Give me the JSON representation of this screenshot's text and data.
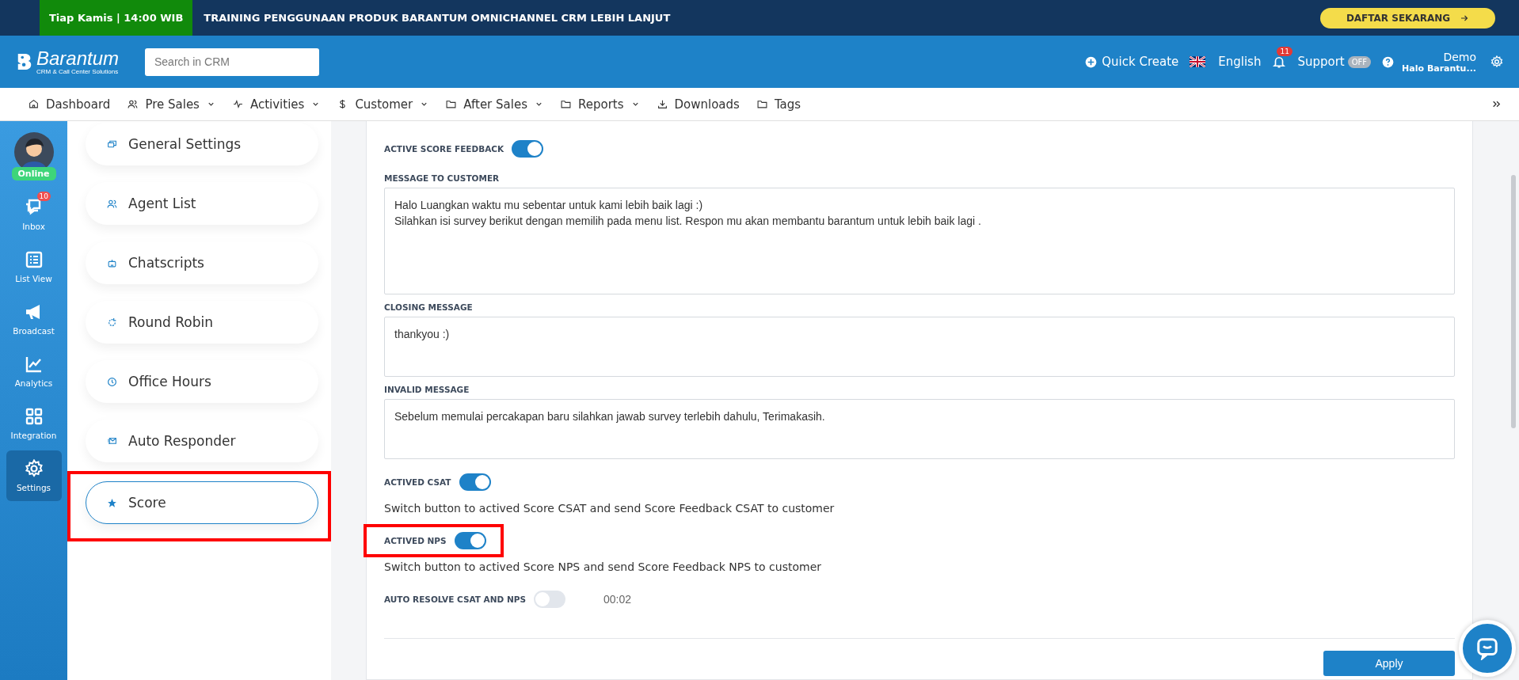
{
  "banner": {
    "tag": "Tiap Kamis | 14:00 WIB",
    "title": "TRAINING PENGGUNAAN PRODUK BARANTUM OMNICHANNEL CRM LEBIH LANJUT",
    "button": "DAFTAR SEKARANG"
  },
  "header": {
    "logo": {
      "name": "Barantum",
      "tagline": "CRM & Call Center Solutions"
    },
    "search": {
      "placeholder": "Search in CRM"
    },
    "quick_create": "Quick Create",
    "language": "English",
    "notifications": "11",
    "support": {
      "label": "Support",
      "badge": "OFF"
    },
    "user": {
      "name": "Demo",
      "company": "Halo Barantu..."
    }
  },
  "nav": [
    {
      "label": "Dashboard",
      "dropdown": false
    },
    {
      "label": "Pre Sales",
      "dropdown": true
    },
    {
      "label": "Activities",
      "dropdown": true
    },
    {
      "label": "Customer",
      "dropdown": true
    },
    {
      "label": "After Sales",
      "dropdown": true
    },
    {
      "label": "Reports",
      "dropdown": true
    },
    {
      "label": "Downloads",
      "dropdown": false
    },
    {
      "label": "Tags",
      "dropdown": false
    }
  ],
  "rail": {
    "status": "Online",
    "items": [
      {
        "label": "Inbox",
        "badge": "10",
        "selected": false
      },
      {
        "label": "List View",
        "selected": false
      },
      {
        "label": "Broadcast",
        "selected": false
      },
      {
        "label": "Analytics",
        "selected": false
      },
      {
        "label": "Integration",
        "selected": false
      },
      {
        "label": "Settings",
        "selected": true
      }
    ]
  },
  "settings_menu": [
    {
      "label": "General Settings",
      "selected": false,
      "highlighted": false
    },
    {
      "label": "Agent List",
      "selected": false,
      "highlighted": false
    },
    {
      "label": "Chatscripts",
      "selected": false,
      "highlighted": false
    },
    {
      "label": "Round Robin",
      "selected": false,
      "highlighted": false
    },
    {
      "label": "Office Hours",
      "selected": false,
      "highlighted": false
    },
    {
      "label": "Auto Responder",
      "selected": false,
      "highlighted": false
    },
    {
      "label": "Score",
      "selected": true,
      "highlighted": true
    }
  ],
  "form": {
    "fields": [
      {
        "kind": "toggle",
        "label": "ACTIVE SCORE FEEDBACK",
        "on": true,
        "highlighted": false
      },
      {
        "kind": "textarea",
        "label": "MESSAGE TO CUSTOMER",
        "value": "Halo Luangkan waktu mu sebentar untuk kami lebih baik lagi :)\nSilahkan isi survey berikut dengan memilih pada menu list. Respon mu akan membantu barantum untuk lebih baik lagi ."
      },
      {
        "kind": "textarea",
        "label": "CLOSING MESSAGE",
        "value": "thankyou :)"
      },
      {
        "kind": "textarea",
        "label": "INVALID MESSAGE",
        "value": "Sebelum memulai percakapan baru silahkan jawab survey terlebih dahulu, Terimakasih."
      },
      {
        "kind": "toggle",
        "label": "ACTIVED CSAT",
        "on": true,
        "highlighted": false,
        "help": "Switch button to actived Score CSAT and send Score Feedback CSAT to customer"
      },
      {
        "kind": "toggle",
        "label": "ACTIVED NPS",
        "on": true,
        "highlighted": true,
        "help": "Switch button to actived Score NPS and send Score Feedback NPS to customer"
      },
      {
        "kind": "toggle",
        "label": "AUTO RESOLVE CSAT AND NPS",
        "on": false,
        "highlighted": false,
        "time": "00:02"
      }
    ],
    "apply": "Apply"
  }
}
